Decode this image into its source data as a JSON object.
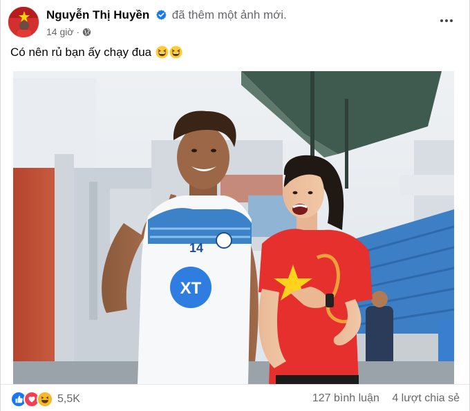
{
  "post": {
    "author": "Nguyễn Thị Huyền",
    "action": "đã thêm một ảnh mới.",
    "time": "14 giờ",
    "separator": "·",
    "audience_icon": "globe-icon",
    "verified_icon": "verified-badge-icon",
    "more_icon": "more-options-icon",
    "caption": "Có nên rủ bạn ấy chạy đua",
    "caption_emojis": [
      "laughing-emoji",
      "laughing-emoji"
    ]
  },
  "photo": {
    "shirt_number": "14",
    "shirt_logo": "XT"
  },
  "footer": {
    "reactions": [
      "like-icon",
      "love-icon",
      "haha-icon"
    ],
    "reaction_count": "5,5K",
    "comments": "127 bình luận",
    "shares": "4 lượt chia sẻ"
  },
  "colors": {
    "text_primary": "#050505",
    "text_secondary": "#65676b",
    "verified_blue": "#1877f2",
    "like_blue": "#1877f2",
    "love_red": "#f33e58",
    "haha_yellow": "#f7b928"
  }
}
